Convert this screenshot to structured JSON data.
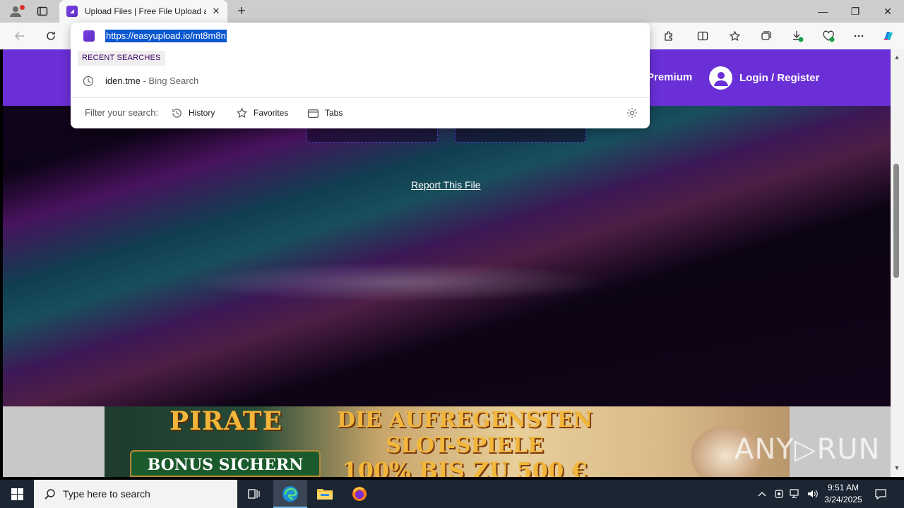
{
  "browser": {
    "tab": {
      "title": "Upload Files | Free File Upload and",
      "close_glyph": "✕"
    },
    "new_tab_glyph": "+",
    "window_controls": {
      "minimize": "—",
      "restore": "❐",
      "close": "✕"
    }
  },
  "omnibox": {
    "url": "https://easyupload.io/mt8m8n",
    "recent_label": "RECENT SEARCHES",
    "recent_items": [
      {
        "query": "iden.tme",
        "suffix": " - Bing Search"
      }
    ],
    "filter_label": "Filter your search:",
    "filters": [
      {
        "label": "History",
        "icon": "history-icon"
      },
      {
        "label": "Favorites",
        "icon": "star-icon"
      },
      {
        "label": "Tabs",
        "icon": "tabs-icon"
      }
    ]
  },
  "page": {
    "nav": {
      "premium": "Premium",
      "login": "Login / Register"
    },
    "report_link": "Report This File"
  },
  "ad": {
    "pirate": "PIRATE",
    "bonus": "BONUS SICHERN",
    "line1": "DIE AUFREGENSTEN",
    "line2": "SLOT-SPIELE",
    "line3": "100% BIS ZU 500 €"
  },
  "watermark": "ANY▷RUN",
  "taskbar": {
    "search_placeholder": "Type here to search",
    "time": "9:51 AM",
    "date": "3/24/2025"
  },
  "colors": {
    "brand_purple": "#6a2fd6",
    "selection_blue": "#0a57d0",
    "taskbar": "#1c2633"
  }
}
